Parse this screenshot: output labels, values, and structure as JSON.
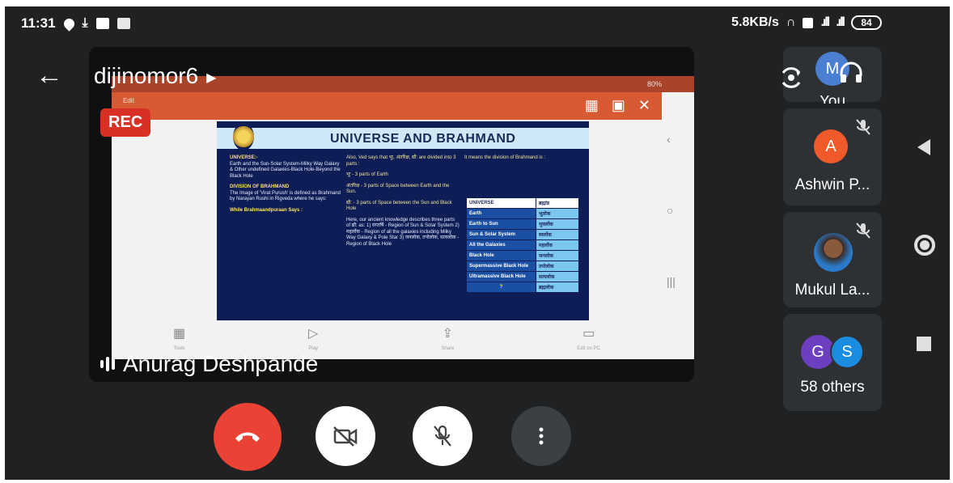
{
  "status_bar": {
    "time": "11:31",
    "network_speed": "5.8KB/s",
    "battery": "84"
  },
  "header": {
    "presenter_name": "dijinomor6",
    "rec_label": "REC"
  },
  "shared_screen": {
    "phone_status": "80%",
    "ppt_title": "Edit",
    "slide": {
      "title": "UNIVERSE AND BRAHMAND",
      "col1": [
        {
          "head": "UNIVERSE:-",
          "text": "Earth and the Sun-Solar System-Milky Way Galaxy & Other undefined Galaxies-Black Hole-Beyond the Black Hole"
        },
        {
          "head": "DIVISION OF BRAHMAND",
          "text": "The Image of 'Virat Purush' is defined as Brahmand by Narayan Rushi in Rigveda where he says:"
        },
        {
          "head": "While Brahmaandpuraan Says :",
          "text": ""
        }
      ],
      "col2": [
        {
          "head": "",
          "text": "Also, Ved says that भूः, अंतरिक्ष, द्यौ: are divided into 3 parts :"
        },
        {
          "head": "",
          "text": "भूः - 3 parts of Earth"
        },
        {
          "head": "",
          "text": "अंतरिक्ष - 3 parts of Space between Earth and the Sun."
        },
        {
          "head": "",
          "text": "द्यौ: - 3 parts of Space between the Sun and Black Hole"
        },
        {
          "head": "",
          "text": "Here, our ancient knowledge describes three parts of द्यौ: as: 1) सप्तर्षि - Region of Sun & Solar System 2) महर्लोक - Region of all the galaxies including Milky Way Galaxy & Pole Star 3) जनलोक, तपोलोक, सत्यलोक - Region of Black Hole"
        }
      ],
      "col3_text": "It means the division of Brahmand is :",
      "table": [
        [
          "UNIVERSE",
          "ब्रह्मांड"
        ],
        [
          "Earth",
          "भूलोक"
        ],
        [
          "Earth to Sun",
          "भुवर्लोक"
        ],
        [
          "Sun & Solar System",
          "स्वर्लोक"
        ],
        [
          "All the Galaxies",
          "महर्लोक"
        ],
        [
          "Black Hole",
          "जनलोक"
        ],
        [
          "Supermassive Black Hole",
          "तपोलोक"
        ],
        [
          "Ultramassive Black Hole",
          "सत्यलोक"
        ],
        [
          "?",
          "ब्रह्मलोक"
        ]
      ]
    },
    "bottom_bar": [
      {
        "label": "Tools",
        "glyph": "▦"
      },
      {
        "label": "Play",
        "glyph": "▷"
      },
      {
        "label": "Share",
        "glyph": "⇪"
      },
      {
        "label": "Edit on PC",
        "glyph": "▭"
      }
    ]
  },
  "speaker": {
    "name": "Anurag Deshpande"
  },
  "participants": [
    {
      "name": "You",
      "initial": "M",
      "color": "#4a7fd1"
    },
    {
      "name": "Ashwin P...",
      "initial": "A",
      "color": "#f0592a"
    },
    {
      "name": "Mukul La...",
      "initial": "",
      "color": "#5b8bbd"
    },
    {
      "name": "58 others",
      "initials": [
        "G",
        "S"
      ],
      "colors": [
        "#6b3fbf",
        "#1a8de0"
      ]
    }
  ],
  "colors": {
    "end_call": "#ea4335",
    "rec": "#d93025",
    "tile_bg": "#2e3134",
    "screen_bg": "#1f2123"
  }
}
